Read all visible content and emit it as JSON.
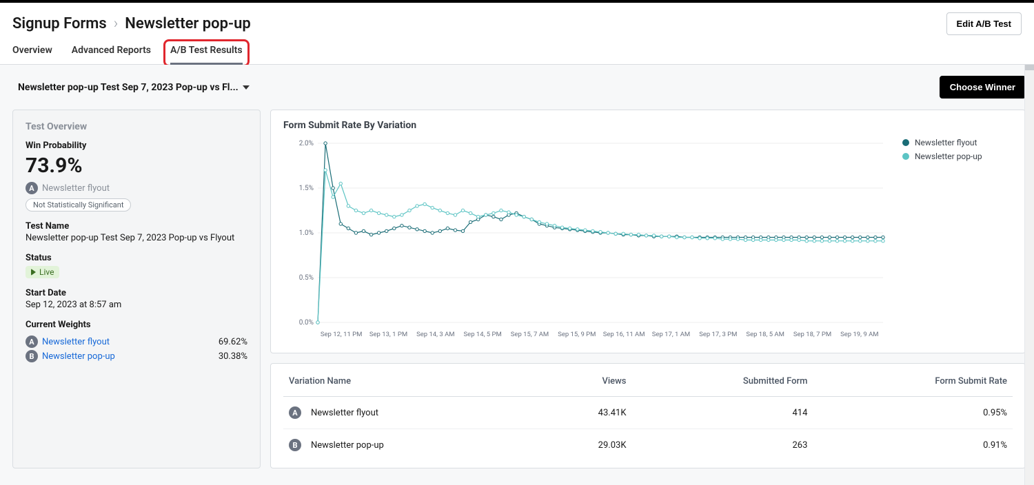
{
  "breadcrumb": {
    "root": "Signup Forms",
    "current": "Newsletter pop-up"
  },
  "header": {
    "editBtn": "Edit A/B Test"
  },
  "tabs": {
    "overview": "Overview",
    "advanced": "Advanced Reports",
    "results": "A/B Test Results"
  },
  "subheader": {
    "dropdown": "Newsletter pop-up Test Sep 7, 2023 Pop-up vs Fl...",
    "chooseWinner": "Choose Winner"
  },
  "overview": {
    "title": "Test Overview",
    "winLabel": "Win Probability",
    "winValue": "73.9%",
    "winnerBadge": "A",
    "winnerName": "Newsletter flyout",
    "sigPill": "Not Statistically Significant",
    "nameLabel": "Test Name",
    "nameValue": "Newsletter pop-up Test Sep 7, 2023 Pop-up vs Flyout",
    "statusLabel": "Status",
    "statusValue": "Live",
    "startLabel": "Start Date",
    "startValue": "Sep 12, 2023 at 8:57 am",
    "weightsLabel": "Current Weights",
    "weights": [
      {
        "badge": "A",
        "name": "Newsletter flyout",
        "pct": "69.62%"
      },
      {
        "badge": "B",
        "name": "Newsletter pop-up",
        "pct": "30.38%"
      }
    ]
  },
  "chart": {
    "title": "Form Submit Rate By Variation",
    "legend": [
      {
        "name": "Newsletter flyout",
        "color": "#196c76"
      },
      {
        "name": "Newsletter pop-up",
        "color": "#5cc4c4"
      }
    ]
  },
  "chart_data": {
    "type": "line",
    "title": "Form Submit Rate By Variation",
    "xlabel": "",
    "ylabel": "",
    "ylim": [
      0,
      2.0
    ],
    "y_ticks": [
      "0.0%",
      "0.5%",
      "1.0%",
      "1.5%",
      "2.0%"
    ],
    "x_ticks": [
      "Sep 12, 11 PM",
      "Sep 13, 1 PM",
      "Sep 14, 3 AM",
      "Sep 14, 5 PM",
      "Sep 15, 7 AM",
      "Sep 15, 9 PM",
      "Sep 16, 11 AM",
      "Sep 17, 1 AM",
      "Sep 17, 3 PM",
      "Sep 18, 5 AM",
      "Sep 18, 7 PM",
      "Sep 19, 9 AM"
    ],
    "series": [
      {
        "name": "Newsletter flyout",
        "color": "#196c76",
        "values": [
          0.0,
          2.0,
          1.5,
          1.1,
          1.05,
          1.0,
          1.02,
          0.98,
          1.0,
          1.02,
          1.05,
          1.08,
          1.06,
          1.04,
          1.02,
          1.0,
          1.02,
          1.05,
          1.03,
          1.02,
          1.12,
          1.15,
          1.2,
          1.18,
          1.15,
          1.2,
          1.22,
          1.18,
          1.15,
          1.1,
          1.08,
          1.06,
          1.05,
          1.04,
          1.03,
          1.02,
          1.01,
          1.0,
          1.0,
          0.99,
          0.98,
          0.98,
          0.97,
          0.97,
          0.96,
          0.96,
          0.96,
          0.96,
          0.95,
          0.95,
          0.95,
          0.95,
          0.95,
          0.95,
          0.95,
          0.95,
          0.95,
          0.95,
          0.95,
          0.95,
          0.95,
          0.95,
          0.95,
          0.95,
          0.95,
          0.95,
          0.95,
          0.95,
          0.95,
          0.95,
          0.95,
          0.95,
          0.95,
          0.95,
          0.95
        ]
      },
      {
        "name": "Newsletter pop-up",
        "color": "#5cc4c4",
        "values": [
          0.0,
          1.7,
          1.4,
          1.55,
          1.3,
          1.25,
          1.22,
          1.25,
          1.22,
          1.2,
          1.18,
          1.2,
          1.25,
          1.3,
          1.32,
          1.28,
          1.25,
          1.22,
          1.2,
          1.25,
          1.22,
          1.18,
          1.2,
          1.22,
          1.25,
          1.23,
          1.2,
          1.18,
          1.15,
          1.12,
          1.1,
          1.08,
          1.06,
          1.05,
          1.04,
          1.03,
          1.02,
          1.01,
          1.0,
          0.99,
          0.99,
          0.98,
          0.98,
          0.97,
          0.97,
          0.96,
          0.96,
          0.95,
          0.95,
          0.95,
          0.94,
          0.94,
          0.94,
          0.93,
          0.93,
          0.93,
          0.92,
          0.92,
          0.92,
          0.92,
          0.92,
          0.92,
          0.92,
          0.92,
          0.91,
          0.91,
          0.91,
          0.91,
          0.91,
          0.91,
          0.91,
          0.91,
          0.91,
          0.91,
          0.91
        ]
      }
    ]
  },
  "table": {
    "headers": {
      "name": "Variation Name",
      "views": "Views",
      "submits": "Submitted Form",
      "rate": "Form Submit Rate"
    },
    "rows": [
      {
        "badge": "A",
        "name": "Newsletter flyout",
        "views": "43.41K",
        "submits": "414",
        "rate": "0.95%"
      },
      {
        "badge": "B",
        "name": "Newsletter pop-up",
        "views": "29.03K",
        "submits": "263",
        "rate": "0.91%"
      }
    ]
  }
}
